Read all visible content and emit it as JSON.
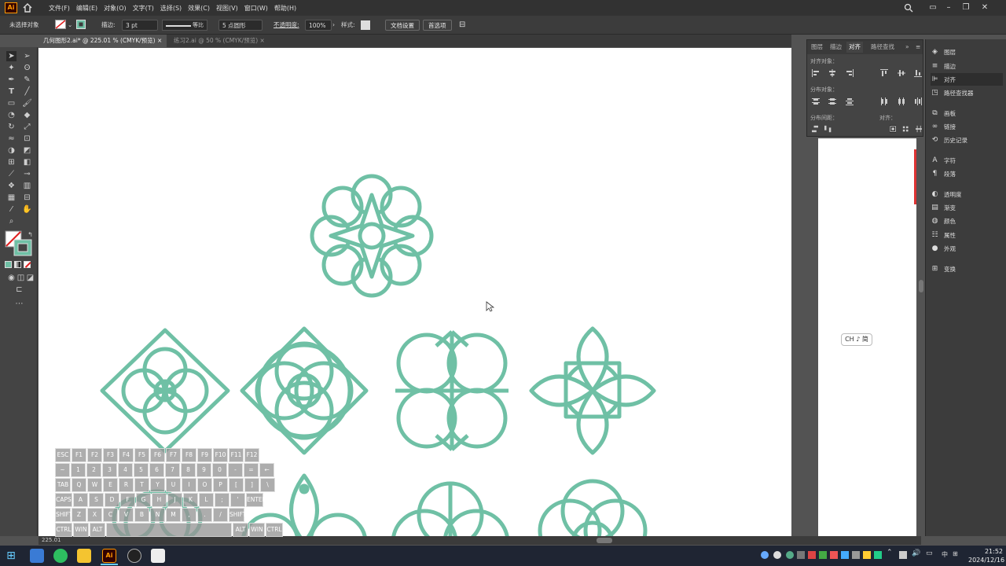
{
  "app": {
    "logo": "Ai"
  },
  "menu": [
    "文件(F)",
    "编辑(E)",
    "对象(O)",
    "文字(T)",
    "选择(S)",
    "效果(C)",
    "视图(V)",
    "窗口(W)",
    "帮助(H)"
  ],
  "control_bar": {
    "selection_status": "未选择对象",
    "stroke_label": "描边:",
    "stroke_value": "3 pt",
    "stroke_profile": "等比",
    "brush": "5 点圆形",
    "opacity_label": "不透明度:",
    "opacity_value": "100%",
    "style_label": "样式:",
    "doc_setup_button": "文档设置",
    "prefs_button": "首选项"
  },
  "tabs": [
    {
      "label": "几何图形2.ai* @ 225.01 % (CMYK/预览)",
      "active": true
    },
    {
      "label": "练习2.ai @ 50 % (CMYK/预览)",
      "active": false
    }
  ],
  "align_panel": {
    "tabs": [
      "图层",
      "描边",
      "对齐",
      "路径查找"
    ],
    "active_tab": "对齐",
    "align_objects": "对齐对象：",
    "distribute_objects": "分布对象：",
    "distribute_spacing": "分布间距：",
    "align_to": "对齐："
  },
  "right_dock": [
    {
      "icon": "layers-icon",
      "label": "图层"
    },
    {
      "icon": "stroke-icon",
      "label": "描边"
    },
    {
      "icon": "align-icon",
      "label": "对齐",
      "active": true
    },
    {
      "icon": "pathfinder-icon",
      "label": "路径查找器"
    },
    {
      "icon": "artboard-icon",
      "label": "画板"
    },
    {
      "icon": "links-icon",
      "label": "链接"
    },
    {
      "icon": "history-icon",
      "label": "历史记录"
    },
    {
      "icon": "character-icon",
      "label": "字符"
    },
    {
      "icon": "paragraph-icon",
      "label": "段落"
    },
    {
      "icon": "transparency-icon",
      "label": "透明度"
    },
    {
      "icon": "gradient-icon",
      "label": "渐变"
    },
    {
      "icon": "color-icon",
      "label": "颜色"
    },
    {
      "icon": "attributes-icon",
      "label": "属性"
    },
    {
      "icon": "appearance-icon",
      "label": "外观"
    },
    {
      "icon": "transform-icon",
      "label": "变换"
    }
  ],
  "ime": "CH ♪ 简",
  "zoom": "225.01",
  "keyboard": {
    "row1": [
      "ESC",
      "F1",
      "F2",
      "F3",
      "F4",
      "F5",
      "F6",
      "F7",
      "F8",
      "F9",
      "F10",
      "F11",
      "F12"
    ],
    "row2": [
      "~",
      "1",
      "2",
      "3",
      "4",
      "5",
      "6",
      "7",
      "8",
      "9",
      "0",
      "-",
      "=",
      "←"
    ],
    "row3": [
      "TAB",
      "Q",
      "W",
      "E",
      "R",
      "T",
      "Y",
      "U",
      "I",
      "O",
      "P",
      "[",
      "]",
      "\\"
    ],
    "row4": [
      "CAPS",
      "A",
      "S",
      "D",
      "F",
      "G",
      "H",
      "J",
      "K",
      "L",
      ";",
      "'",
      "ENTER"
    ],
    "row5": [
      "SHIFT",
      "Z",
      "X",
      "C",
      "V",
      "B",
      "N",
      "M",
      ",",
      ".",
      "/",
      "SHIFT"
    ],
    "row6": [
      "CTRL",
      "WIN",
      "ALT",
      "ALT",
      "WIN",
      "CTRL"
    ]
  },
  "taskbar": {
    "time": "21:52",
    "date": "2024/12/16",
    "lang": "中"
  },
  "colors": {
    "shape": "#6fc0a5",
    "canvas": "#ffffff",
    "ui_dark": "#323232",
    "accent": "#ff9a00"
  }
}
